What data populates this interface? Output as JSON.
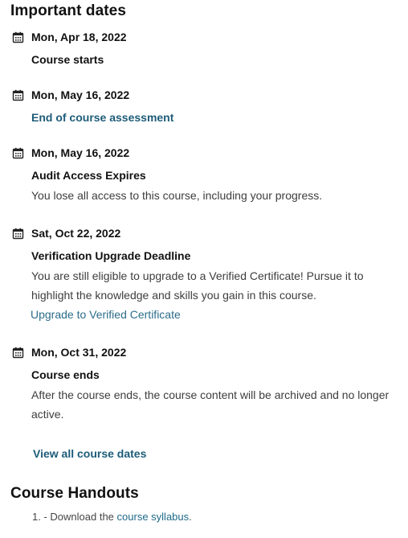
{
  "important_dates": {
    "title": "Important dates",
    "items": [
      {
        "date": "Mon, Apr 18, 2022",
        "event": "Course starts",
        "event_is_link": false,
        "icon": "calendar-icon"
      },
      {
        "date": "Mon, May 16, 2022",
        "event": "End of course assessment",
        "event_is_link": true,
        "icon": "calendar-icon"
      },
      {
        "date": "Mon, May 16, 2022",
        "event": "Audit Access Expires",
        "event_is_link": false,
        "description": "You lose all access to this course, including your progress.",
        "icon": "calendar-icon"
      },
      {
        "date": "Sat, Oct 22, 2022",
        "event": "Verification Upgrade Deadline",
        "event_is_link": false,
        "description": "You are still eligible to upgrade to a Verified Certificate! Pursue it to highlight the knowledge and skills you gain in this course.",
        "action_link": "Upgrade to Verified Certificate",
        "icon": "calendar-icon"
      },
      {
        "date": "Mon, Oct 31, 2022",
        "event": "Course ends",
        "event_is_link": false,
        "description": "After the course ends, the course content will be archived and no longer active.",
        "icon": "calendar-icon"
      }
    ],
    "view_all_label": "View all course dates"
  },
  "course_handouts": {
    "title": "Course Handouts",
    "items": [
      {
        "number": "1.",
        "prefix": "- Download the ",
        "link_text": "course syllabus",
        "suffix": "."
      }
    ]
  },
  "colors": {
    "link": "#1d5c78",
    "text": "#212529",
    "muted": "#3d3d3d"
  }
}
